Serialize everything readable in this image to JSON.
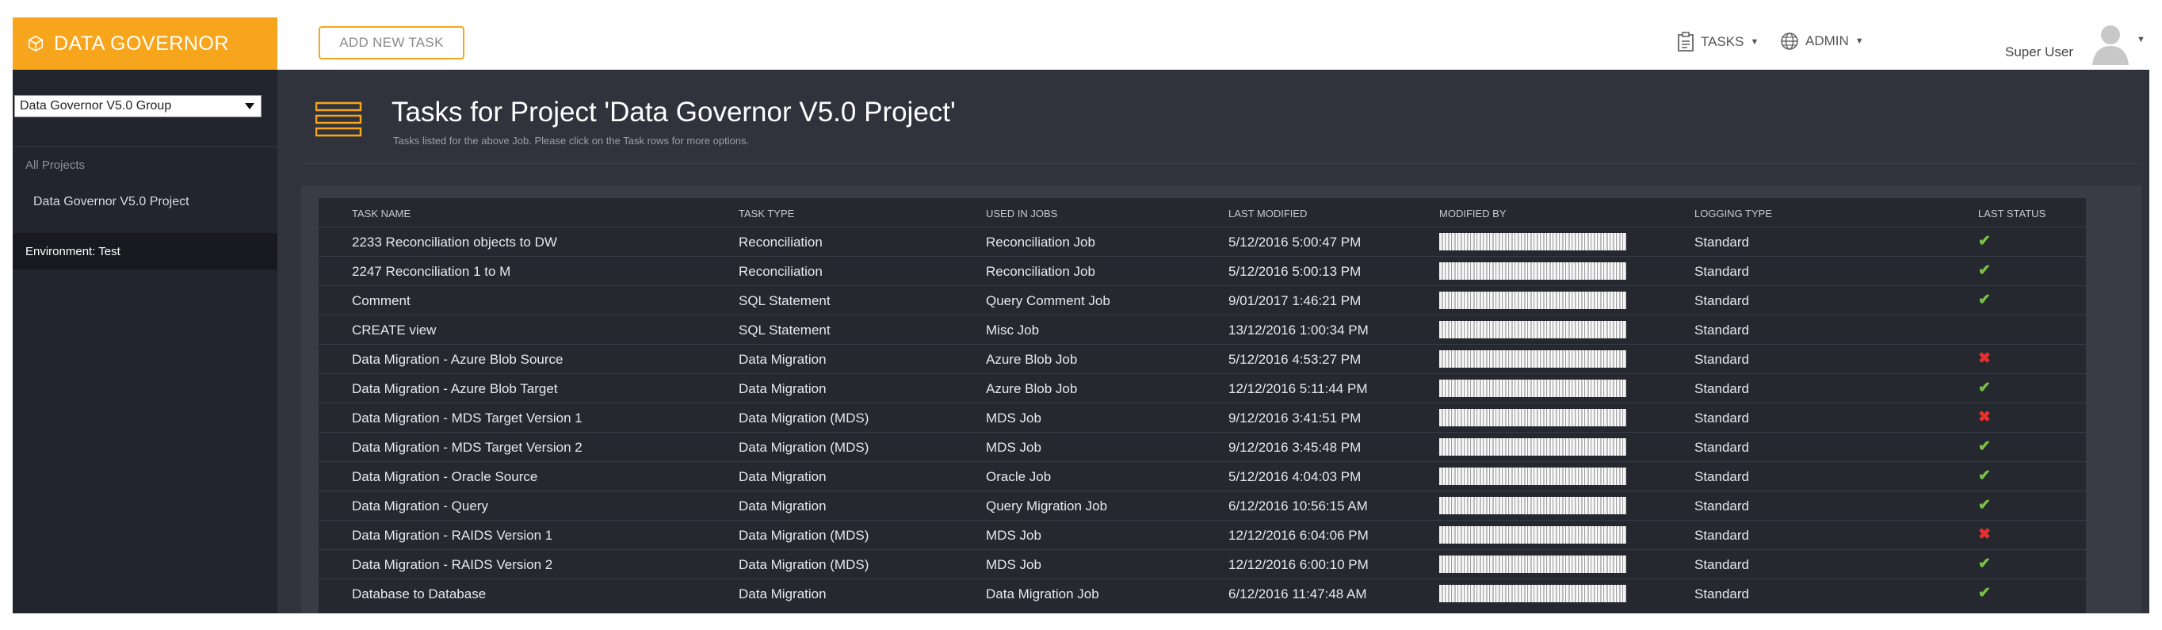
{
  "app": {
    "title": "DATA GOVERNOR"
  },
  "toolbar": {
    "add_task_label": "ADD NEW TASK"
  },
  "top_menu": {
    "tasks_label": "TASKS",
    "admin_label": "ADMIN",
    "user_name": "Super User"
  },
  "sidebar": {
    "group_selected": "Data Governor V5.0 Group",
    "all_projects_label": "All Projects",
    "project_item": "Data Governor V5.0 Project",
    "environment_label": "Environment: Test"
  },
  "page": {
    "title": "Tasks for Project 'Data Governor V5.0 Project'",
    "subtitle": "Tasks listed for the above Job. Please click on the Task rows for more options."
  },
  "table": {
    "headers": [
      "TASK NAME",
      "TASK TYPE",
      "USED IN JOBS",
      "LAST MODIFIED",
      "MODIFIED BY",
      "LOGGING TYPE",
      "LAST STATUS"
    ],
    "rows": [
      {
        "name": "2233 Reconciliation objects to DW",
        "type": "Reconciliation",
        "jobs": "Reconciliation Job",
        "modified": "5/12/2016 5:00:47 PM",
        "logging": "Standard",
        "status": "ok"
      },
      {
        "name": "2247 Reconciliation 1 to M",
        "type": "Reconciliation",
        "jobs": "Reconciliation Job",
        "modified": "5/12/2016 5:00:13 PM",
        "logging": "Standard",
        "status": "ok"
      },
      {
        "name": "Comment",
        "type": "SQL Statement",
        "jobs": "Query Comment Job",
        "modified": "9/01/2017 1:46:21 PM",
        "logging": "Standard",
        "status": "ok"
      },
      {
        "name": "CREATE view",
        "type": "SQL Statement",
        "jobs": "Misc Job",
        "modified": "13/12/2016 1:00:34 PM",
        "logging": "Standard",
        "status": "none"
      },
      {
        "name": "Data Migration - Azure Blob Source",
        "type": "Data Migration",
        "jobs": "Azure Blob Job",
        "modified": "5/12/2016 4:53:27 PM",
        "logging": "Standard",
        "status": "fail"
      },
      {
        "name": "Data Migration - Azure Blob Target",
        "type": "Data Migration",
        "jobs": "Azure Blob Job",
        "modified": "12/12/2016 5:11:44 PM",
        "logging": "Standard",
        "status": "ok"
      },
      {
        "name": "Data Migration - MDS Target Version 1",
        "type": "Data Migration (MDS)",
        "jobs": "MDS Job",
        "modified": "9/12/2016 3:41:51 PM",
        "logging": "Standard",
        "status": "fail"
      },
      {
        "name": "Data Migration - MDS Target Version 2",
        "type": "Data Migration (MDS)",
        "jobs": "MDS Job",
        "modified": "9/12/2016 3:45:48 PM",
        "logging": "Standard",
        "status": "ok"
      },
      {
        "name": "Data Migration - Oracle Source",
        "type": "Data Migration",
        "jobs": "Oracle Job",
        "modified": "5/12/2016 4:04:03 PM",
        "logging": "Standard",
        "status": "ok"
      },
      {
        "name": "Data Migration - Query",
        "type": "Data Migration",
        "jobs": "Query Migration Job",
        "modified": "6/12/2016 10:56:15 AM",
        "logging": "Standard",
        "status": "ok"
      },
      {
        "name": "Data Migration - RAIDS Version 1",
        "type": "Data Migration (MDS)",
        "jobs": "MDS Job",
        "modified": "12/12/2016 6:04:06 PM",
        "logging": "Standard",
        "status": "fail"
      },
      {
        "name": "Data Migration - RAIDS Version 2",
        "type": "Data Migration (MDS)",
        "jobs": "MDS Job",
        "modified": "12/12/2016 6:00:10 PM",
        "logging": "Standard",
        "status": "ok"
      },
      {
        "name": "Database to Database",
        "type": "Data Migration",
        "jobs": "Data Migration Job",
        "modified": "6/12/2016 11:47:48 AM",
        "logging": "Standard",
        "status": "ok"
      }
    ]
  },
  "icons": {
    "status_ok": "✔",
    "status_fail": "✖",
    "logo_icon": "cube-icon",
    "tasks_icon": "clipboard-icon",
    "admin_icon": "globe-icon",
    "page_icon": "list-icon"
  },
  "colors": {
    "accent": "#f7a51c",
    "ok": "#79c143",
    "fail": "#e8302a"
  }
}
